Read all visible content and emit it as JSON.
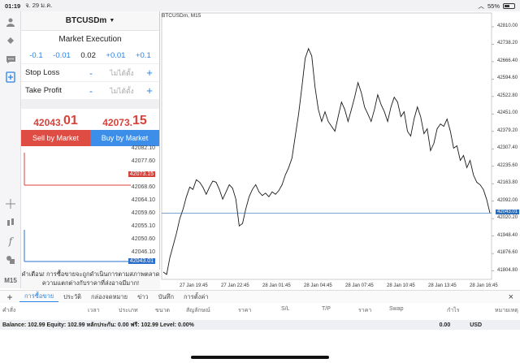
{
  "status_bar": {
    "time": "01:19",
    "date": "จ. 29 ม.ค.",
    "battery": "55%"
  },
  "order_panel": {
    "symbol": "BTCUSDm",
    "execution": "Market Execution",
    "volume": {
      "minus_big": "-0.1",
      "minus_small": "-0.01",
      "value": "0.02",
      "plus_small": "+0.01",
      "plus_big": "+0.1"
    },
    "stop_loss": {
      "label": "Stop Loss",
      "placeholder": "ไม่ได้ตั้ง",
      "minus": "-",
      "plus": "+"
    },
    "take_profit": {
      "label": "Take Profit",
      "placeholder": "ไม่ได้ตั้ง",
      "minus": "-",
      "plus": "+"
    },
    "bid": {
      "main": "42043.",
      "big": "01"
    },
    "ask": {
      "main": "42073.",
      "big": "15"
    },
    "sell_label": "Sell by Market",
    "buy_label": "Buy by Market",
    "tick_levels": [
      "42082.10",
      "42077.60",
      "42073.15",
      "42068.60",
      "42064.10",
      "42059.60",
      "42055.10",
      "42050.60",
      "42046.10",
      "42043.01"
    ],
    "warning_line1": "คำเตือน! การซื้อขายจะถูกดำเนินการตามสภาพตลาด",
    "warning_line2": "ความแตกต่างกับราคาที่ส่งอาจมีมาก!"
  },
  "left_toolbar": {
    "timeframe": "M15"
  },
  "chart": {
    "title": "BTCUSDm, M15",
    "current_price": "42043.01",
    "colors": {
      "line": "#1a1a1a",
      "current": "#2b6cb8",
      "bid": "#d7433b"
    }
  },
  "chart_data": {
    "type": "line",
    "title": "BTCUSDm, M15",
    "xlabel": "",
    "ylabel": "",
    "ylim": [
      41770,
      42840
    ],
    "y_ticks": [
      "42810.00",
      "42738.20",
      "42666.40",
      "42594.60",
      "42522.80",
      "42451.00",
      "42379.20",
      "42307.40",
      "42235.60",
      "42163.80",
      "42092.00",
      "42020.20",
      "41948.40",
      "41876.60",
      "41804.80"
    ],
    "x_ticks": [
      "27 Jan 19:45",
      "27 Jan 22:45",
      "28 Jan 01:45",
      "28 Jan 04:45",
      "28 Jan 07:45",
      "28 Jan 10:45",
      "28 Jan 13:45",
      "28 Jan 16:45"
    ],
    "values": [
      41800,
      41790,
      41860,
      41910,
      41960,
      42020,
      42060,
      42110,
      42150,
      42140,
      42180,
      42170,
      42150,
      42120,
      42150,
      42175,
      42170,
      42140,
      42100,
      42130,
      42160,
      42145,
      42100,
      41990,
      42000,
      42060,
      42110,
      42140,
      42160,
      42130,
      42115,
      42125,
      42110,
      42130,
      42120,
      42135,
      42160,
      42200,
      42230,
      42270,
      42360,
      42450,
      42560,
      42680,
      42720,
      42690,
      42560,
      42470,
      42420,
      42460,
      42420,
      42400,
      42380,
      42440,
      42500,
      42470,
      42420,
      42470,
      42520,
      42580,
      42540,
      42480,
      42450,
      42420,
      42470,
      42530,
      42490,
      42460,
      42420,
      42480,
      42520,
      42500,
      42440,
      42460,
      42380,
      42360,
      42430,
      42480,
      42440,
      42370,
      42390,
      42300,
      42330,
      42390,
      42410,
      42400,
      42430,
      42380,
      42310,
      42320,
      42260,
      42280,
      42230,
      42260,
      42200,
      42170,
      42160,
      42140,
      42100,
      42043.01
    ],
    "current_price": 42043.01
  },
  "bottom_tabs": {
    "plus": "+",
    "items": [
      "การซื้อขาย",
      "ประวัติ",
      "กล่องจดหมาย",
      "ข่าว",
      "บันทึก",
      "การตั้งค่า"
    ],
    "close": "×"
  },
  "columns": [
    "คำสั่ง",
    "เวลา",
    "ประเภท",
    "ขนาด",
    "สัญลักษณ์",
    "ราคา",
    "S/L",
    "T/P",
    "ราคา",
    "Swap",
    "กำไร",
    "หมายเหตุ"
  ],
  "balance": {
    "text": "Balance: 102.99 Equity: 102.99 หลักประกัน: 0.00 ฟรี: 102.99 Level: 0.00%",
    "profit": "0.00",
    "currency": "USD"
  }
}
